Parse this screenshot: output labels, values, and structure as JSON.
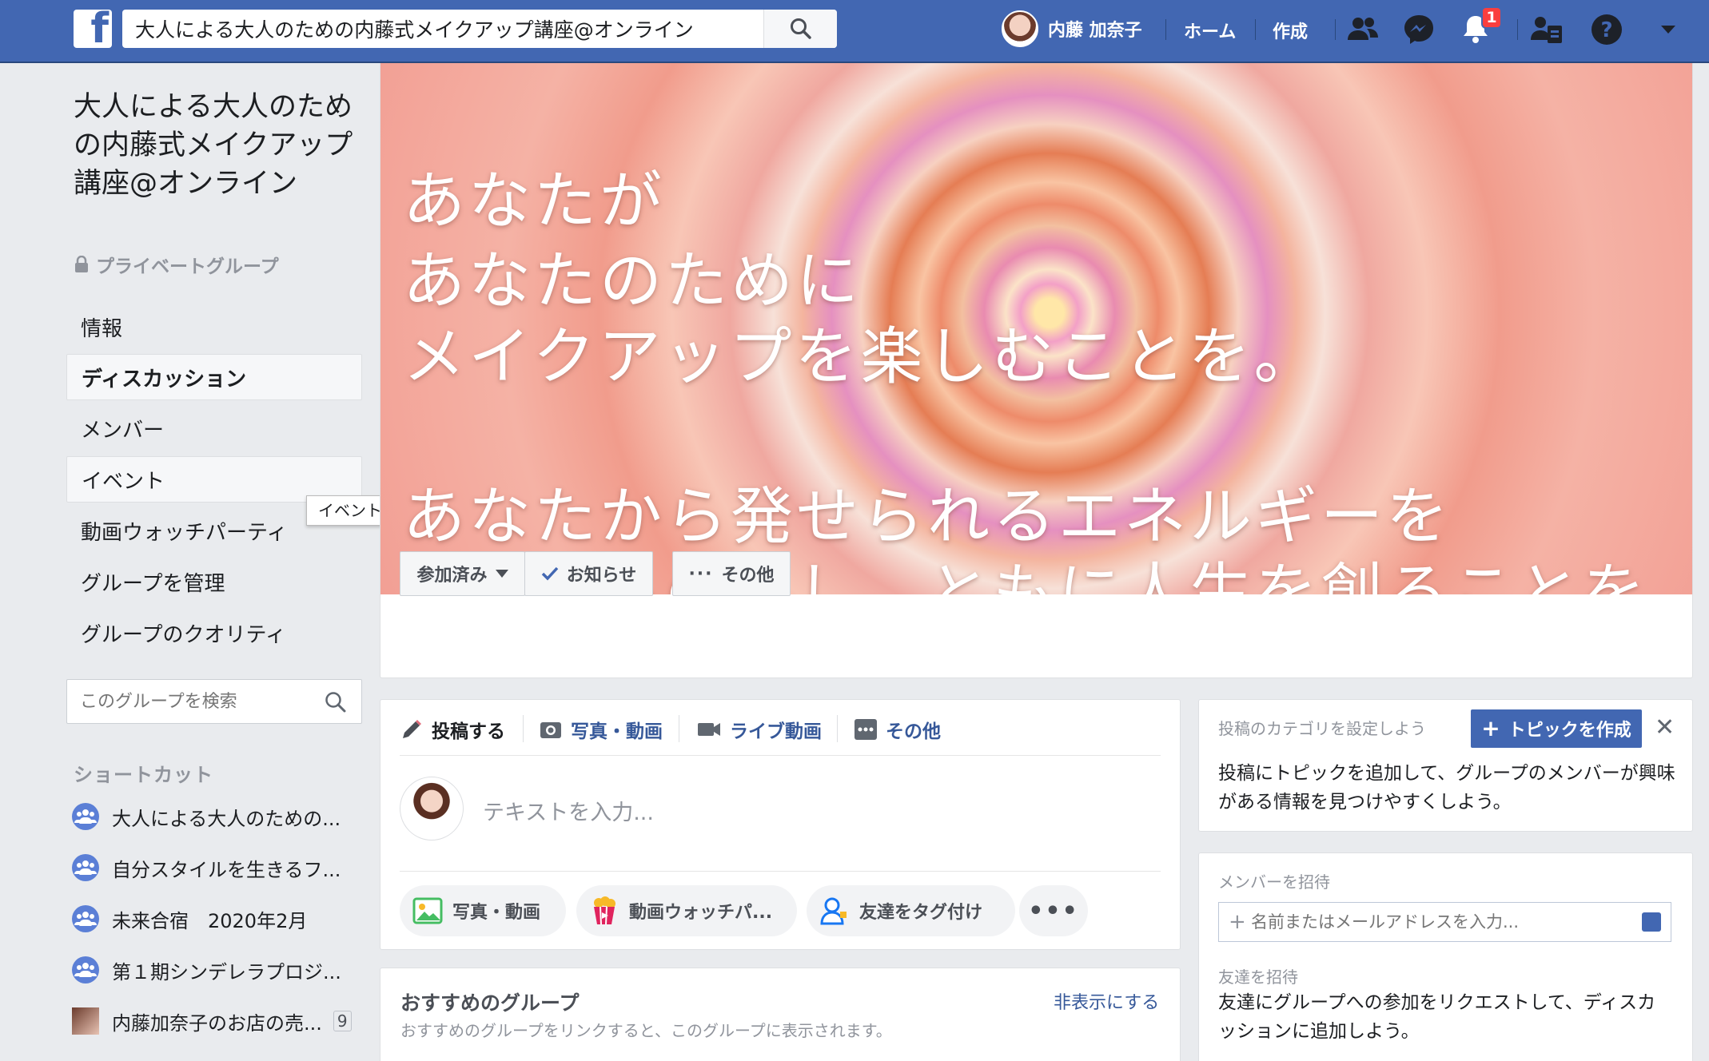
{
  "topbar": {
    "search_value": "大人による大人のための内藤式メイクアップ講座@オンライン",
    "user_name": "内藤 加奈子",
    "home_label": "ホーム",
    "create_label": "作成",
    "notification_count": "1",
    "icons": [
      "facebook-logo-icon",
      "search-icon",
      "friends-icon",
      "messenger-icon",
      "bell-icon",
      "friend-suggestions-icon",
      "help-icon",
      "caret-down-icon"
    ]
  },
  "group": {
    "title": "大人による大人のための内藤式メイクアップ講座@オンライン",
    "privacy": "プライベートグループ"
  },
  "leftnav": {
    "items": [
      "情報",
      "ディスカッション",
      "メンバー",
      "イベント",
      "動画ウォッチパーティ",
      "グループを管理",
      "グループのクオリティ"
    ],
    "tooltip": "イベント",
    "search_placeholder": "このグループを検索",
    "shortcuts_heading": "ショートカット",
    "shortcuts": [
      {
        "label": "大人による大人のための..."
      },
      {
        "label": "自分スタイルを生きるフ..."
      },
      {
        "label": "未来合宿　2020年2月"
      },
      {
        "label": "第１期シンデレラプロジ..."
      },
      {
        "label": "内藤加奈子のお店の売...",
        "count": "9"
      }
    ]
  },
  "cover": {
    "lines": [
      "あなたが",
      "あなたのために",
      "メイクアップを楽しむことを。",
      "あなたから発せられるエネルギーを",
      "最良のものとし、ともに人生を創ることを"
    ],
    "joined_label": "参加済み",
    "notify_label": "お知らせ",
    "more_label": "その他"
  },
  "composer": {
    "tabs": [
      "投稿する",
      "写真・動画",
      "ライブ動画",
      "その他"
    ],
    "placeholder": "テキストを入力...",
    "pills": [
      "写真・動画",
      "動画ウォッチパ...",
      "友達をタグ付け"
    ]
  },
  "recommended": {
    "title": "おすすめのグループ",
    "subtitle": "おすすめのグループをリンクすると、このグループに表示されます。",
    "hide_label": "非表示にする"
  },
  "right": {
    "topic_heading": "投稿のカテゴリを設定しよう",
    "topic_button": "トピックを作成",
    "topic_text": "投稿にトピックを追加して、グループのメンバーが興味がある情報を見つけやすくしよう。",
    "invite_heading": "メンバーを招待",
    "invite_placeholder": "名前またはメールアドレスを入力...",
    "friends_heading": "友達を招待",
    "friends_text": "友達にグループへの参加をリクエストして、ディスカッションに追加しよう。"
  },
  "colors": {
    "brand": "#4267b2",
    "link": "#365899",
    "badge": "#fa3e3e"
  }
}
